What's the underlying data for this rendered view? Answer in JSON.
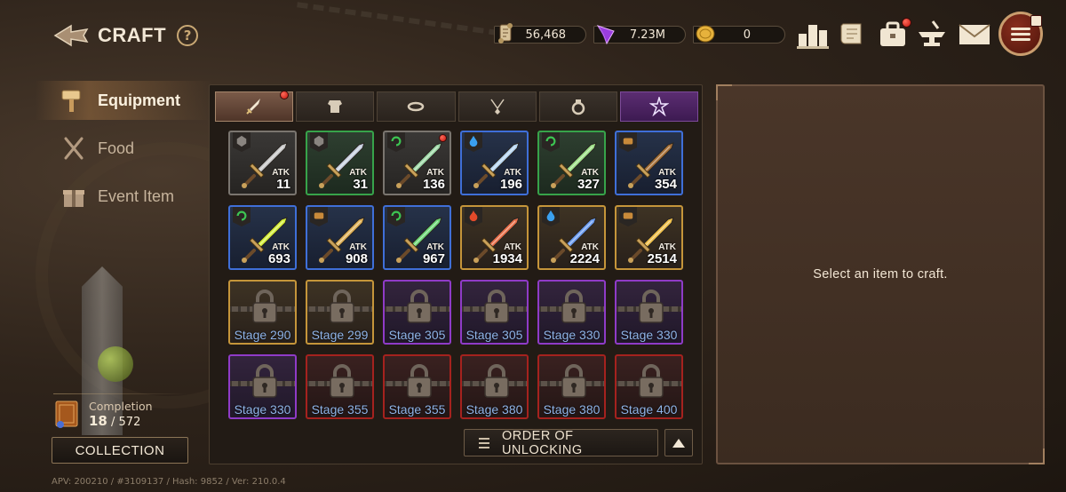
{
  "header": {
    "title": "CRAFT",
    "help": "?"
  },
  "currencies": [
    {
      "name": "scroll-currency",
      "value": "56,468"
    },
    {
      "name": "crystal-currency",
      "value": "7.23M"
    },
    {
      "name": "gold-coin-currency",
      "value": "0"
    }
  ],
  "sidebar": {
    "items": [
      {
        "label": "Equipment",
        "icon": "hammer-icon",
        "active": true
      },
      {
        "label": "Food",
        "icon": "fork-knife-icon",
        "active": false
      },
      {
        "label": "Event Item",
        "icon": "gift-icon",
        "active": false
      }
    ]
  },
  "completion": {
    "label": "Completion",
    "current": "18",
    "total": "/ 572"
  },
  "collection_button": "COLLECTION",
  "footer": "APV: 200210 / #3109137 / Hash: 9852 / Ver: 210.0.4",
  "tabs": [
    "sword-tab",
    "armor-tab",
    "belt-tab",
    "necklace-tab",
    "ring-tab",
    "special-tab"
  ],
  "atk_label": "ATK",
  "items": [
    {
      "atk": "11",
      "rarity": "gray",
      "element": "neutral",
      "color": "#c9c9c9",
      "new": false
    },
    {
      "atk": "31",
      "rarity": "green",
      "element": "neutral",
      "color": "#c8d0e0",
      "new": false
    },
    {
      "atk": "136",
      "rarity": "gray",
      "element": "wind",
      "color": "#9fd9a8",
      "new": true
    },
    {
      "atk": "196",
      "rarity": "blue",
      "element": "water",
      "color": "#b8d6f2",
      "new": false
    },
    {
      "atk": "327",
      "rarity": "green",
      "element": "wind",
      "color": "#9fe28a",
      "new": false
    },
    {
      "atk": "354",
      "rarity": "blue",
      "element": "earth",
      "color": "#a8723a",
      "new": false
    },
    {
      "atk": "693",
      "rarity": "blue",
      "element": "wind",
      "color": "#d6ef3c",
      "new": false
    },
    {
      "atk": "908",
      "rarity": "blue",
      "element": "earth",
      "color": "#e0b25a",
      "new": false
    },
    {
      "atk": "967",
      "rarity": "blue",
      "element": "wind",
      "color": "#6fd97a",
      "new": false
    },
    {
      "atk": "1934",
      "rarity": "gold",
      "element": "fire",
      "color": "#e8704a",
      "new": false
    },
    {
      "atk": "2224",
      "rarity": "gold",
      "element": "water",
      "color": "#6f9ff2",
      "new": false
    },
    {
      "atk": "2514",
      "rarity": "gold",
      "element": "earth",
      "color": "#f0c04a",
      "new": false
    }
  ],
  "locked": [
    {
      "stage": "Stage 290",
      "rarity": "gold"
    },
    {
      "stage": "Stage 299",
      "rarity": "gold"
    },
    {
      "stage": "Stage 305",
      "rarity": "purple"
    },
    {
      "stage": "Stage 305",
      "rarity": "purple"
    },
    {
      "stage": "Stage 330",
      "rarity": "purple"
    },
    {
      "stage": "Stage 330",
      "rarity": "purple"
    },
    {
      "stage": "Stage 330",
      "rarity": "purple"
    },
    {
      "stage": "Stage 355",
      "rarity": "red"
    },
    {
      "stage": "Stage 355",
      "rarity": "red"
    },
    {
      "stage": "Stage 380",
      "rarity": "red"
    },
    {
      "stage": "Stage 380",
      "rarity": "red"
    },
    {
      "stage": "Stage 400",
      "rarity": "red"
    }
  ],
  "order_button": "ORDER OF UNLOCKING",
  "detail": {
    "empty_message": "Select an item to craft."
  },
  "colors": {
    "accent": "#c9a874",
    "panel": "#221b15",
    "detail": "#4a3629"
  }
}
